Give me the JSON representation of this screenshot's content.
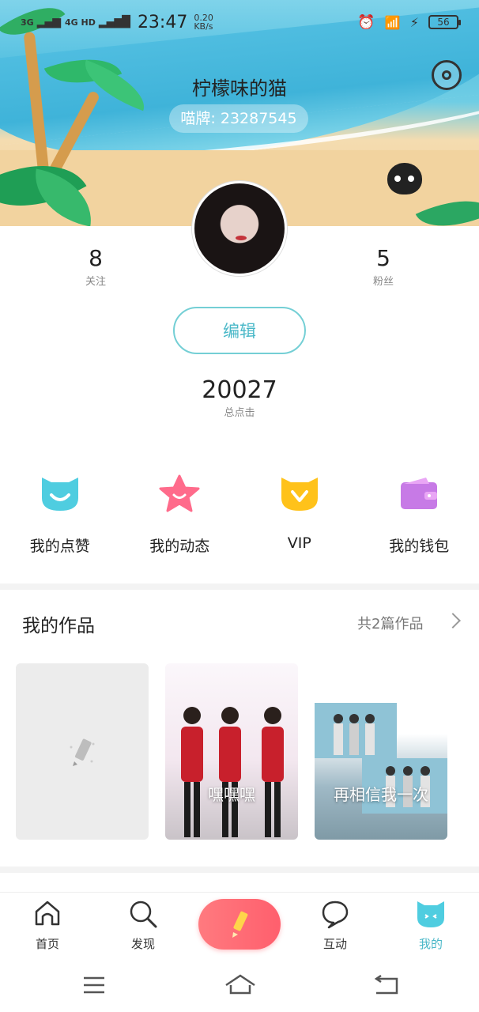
{
  "status_bar": {
    "signal_1": "3G",
    "signal_2": "4G HD",
    "time": "23:47",
    "net_speed_value": "0.20",
    "net_speed_unit": "KB/s",
    "battery": "56"
  },
  "profile": {
    "username": "柠檬味的猫",
    "badge": "喵牌: 23287545",
    "following_count": "8",
    "following_label": "关注",
    "fans_count": "5",
    "fans_label": "粉丝",
    "edit_label": "编辑",
    "total_clicks": "20027",
    "total_clicks_label": "总点击"
  },
  "menu": [
    {
      "label": "我的点赞",
      "icon": "cat-smile-icon",
      "color": "#4fcde0"
    },
    {
      "label": "我的动态",
      "icon": "star-face-icon",
      "color": "#ff6b8b"
    },
    {
      "label": "VIP",
      "icon": "vip-cat-icon",
      "color": "#ffc21a"
    },
    {
      "label": "我的钱包",
      "icon": "wallet-icon",
      "color": "#c77ae6"
    }
  ],
  "works": {
    "title": "我的作品",
    "count_label": "共2篇作品",
    "items": [
      {
        "title": ""
      },
      {
        "title": "嘿嘿嘿"
      },
      {
        "title": "再相信我一次"
      }
    ]
  },
  "nav": {
    "home": "首页",
    "discover": "发现",
    "interact": "互动",
    "mine": "我的"
  },
  "colors": {
    "accent": "#4ab8c8",
    "create_button": "#ff6470"
  }
}
